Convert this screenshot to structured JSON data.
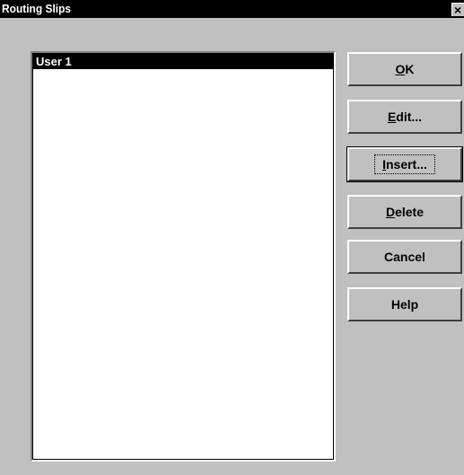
{
  "window": {
    "title": "Routing Slips",
    "close_glyph": "×"
  },
  "list": {
    "items": [
      {
        "label": "User 1",
        "selected": true
      }
    ]
  },
  "buttons": {
    "ok": {
      "mnemonic": "O",
      "rest": "K"
    },
    "edit": {
      "mnemonic": "E",
      "rest": "dit..."
    },
    "insert": {
      "mnemonic": "I",
      "rest": "nsert..."
    },
    "delete": {
      "mnemonic": "D",
      "rest": "elete"
    },
    "cancel": {
      "label": "Cancel"
    },
    "help": {
      "label": "Help"
    }
  }
}
